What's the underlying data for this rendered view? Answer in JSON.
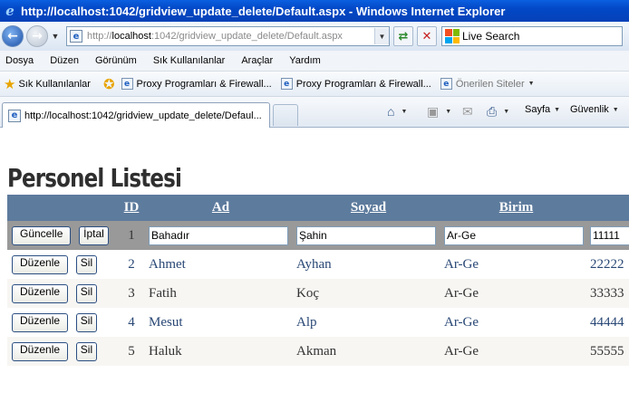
{
  "window": {
    "title": "http://localhost:1042/gridview_update_delete/Default.aspx - Windows Internet Explorer"
  },
  "address": {
    "url_prefix": "http://",
    "url_host": "localhost",
    "url_rest": ":1042/gridview_update_delete/Default.aspx",
    "search_placeholder": "Live Search"
  },
  "menu": {
    "items": [
      "Dosya",
      "Düzen",
      "Görünüm",
      "Sık Kullanılanlar",
      "Araçlar",
      "Yardım"
    ]
  },
  "favorites": {
    "label": "Sık Kullanılanlar",
    "links": [
      "Proxy Programları & Firewall...",
      "Proxy Programları & Firewall...",
      "Önerilen Siteler"
    ]
  },
  "tabs": {
    "active_label": "http://localhost:1042/gridview_update_delete/Defaul...",
    "commands": [
      "Sayfa",
      "Güvenlik"
    ]
  },
  "page": {
    "title": "Personel Listesi",
    "grid": {
      "headers": [
        "ID",
        "Ad",
        "Soyad",
        "Birim"
      ],
      "edit_row": {
        "id": "1",
        "ad": "Bahadır",
        "soyad": "Şahin",
        "birim": "Ar-Ge",
        "tel": "11111",
        "update_label": "Güncelle",
        "cancel_label": "İptal"
      },
      "rows": [
        {
          "id": "2",
          "ad": "Ahmet",
          "soyad": "Ayhan",
          "birim": "Ar-Ge",
          "tel": "22222"
        },
        {
          "id": "3",
          "ad": "Fatih",
          "soyad": "Koç",
          "birim": "Ar-Ge",
          "tel": "33333"
        },
        {
          "id": "4",
          "ad": "Mesut",
          "soyad": "Alp",
          "birim": "Ar-Ge",
          "tel": "44444"
        },
        {
          "id": "5",
          "ad": "Haluk",
          "soyad": "Akman",
          "birim": "Ar-Ge",
          "tel": "55555"
        }
      ],
      "edit_label": "Düzenle",
      "delete_label": "Sil",
      "colors": {
        "header": "#5d7b9d",
        "edit_row": "#999999",
        "alt_row": "#f7f6f3",
        "link_text": "#284775"
      }
    }
  },
  "icons": [
    "ie-logo-icon",
    "back-icon",
    "forward-icon",
    "refresh-icon",
    "stop-icon",
    "live-search-icon",
    "favorites-star-icon",
    "add-favorite-icon",
    "home-icon",
    "feeds-icon",
    "mail-icon",
    "print-icon"
  ]
}
